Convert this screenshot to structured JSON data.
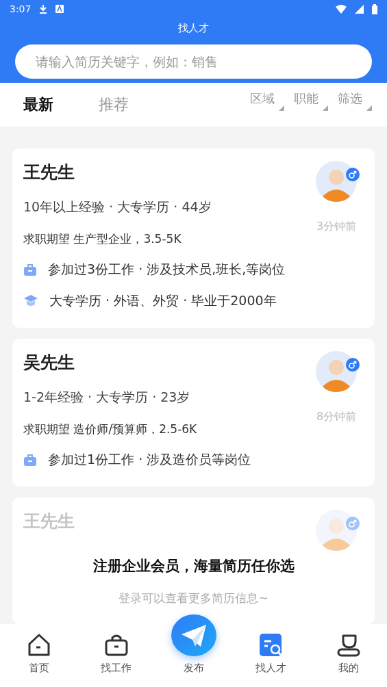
{
  "status_bar": {
    "time": "3:07"
  },
  "header": {
    "title": "找人才"
  },
  "search": {
    "placeholder": "请输入简历关键字，例如：销售"
  },
  "tabs": [
    {
      "label": "最新",
      "selected": true
    },
    {
      "label": "推荐",
      "selected": false
    }
  ],
  "filters": [
    {
      "label": "区域"
    },
    {
      "label": "职能"
    },
    {
      "label": "筛选"
    }
  ],
  "resumes": [
    {
      "name": "王先生",
      "locked": false,
      "summary": "10年以上经验 · 大专学历 · 44岁",
      "expectation": "求职期望 生产型企业，3.5-5K",
      "time": "3分钟前",
      "details": [
        {
          "kind": "work",
          "text": "参加过3份工作 · 涉及技术员,班长,等岗位"
        },
        {
          "kind": "education",
          "text": "大专学历 · 外语、外贸 · 毕业于2000年"
        }
      ]
    },
    {
      "name": "吴先生",
      "locked": false,
      "summary": "1-2年经验 · 大专学历 · 23岁",
      "expectation": "求职期望 造价师/预算师，2.5-6K",
      "time": "8分钟前",
      "details": [
        {
          "kind": "work",
          "text": "参加过1份工作 · 涉及造价员等岗位"
        }
      ]
    },
    {
      "name": "王先生",
      "locked": true
    }
  ],
  "login_prompt": {
    "title": "注册企业会员，海量简历任你选",
    "subtitle": "登录可以查看更多简历信息~"
  },
  "nav": [
    {
      "label": "首页",
      "kind": "home",
      "selected": false
    },
    {
      "label": "找工作",
      "kind": "jobs",
      "selected": false
    },
    {
      "label": "发布",
      "kind": "publish"
    },
    {
      "label": "找人才",
      "kind": "talent",
      "selected": true
    },
    {
      "label": "我的",
      "kind": "profile",
      "selected": false
    }
  ]
}
